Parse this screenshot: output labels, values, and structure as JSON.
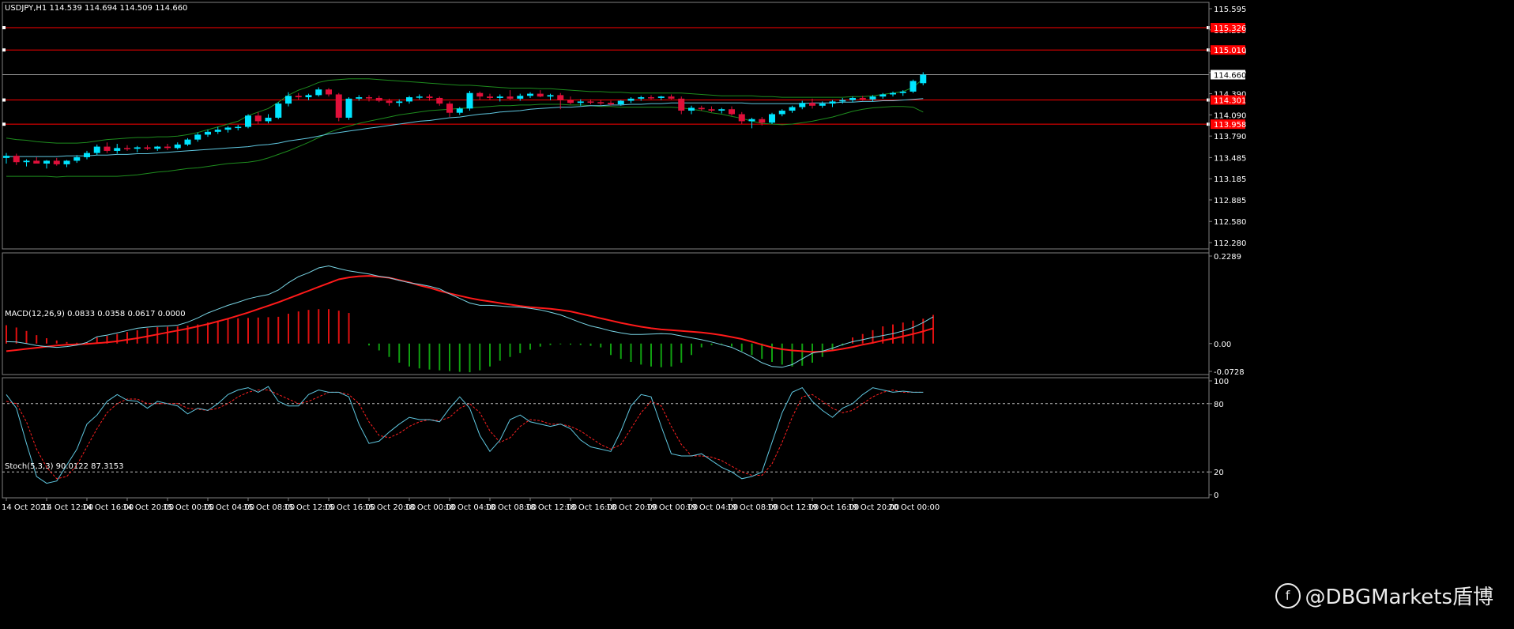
{
  "window": {
    "symbol_header": "USDJPY,H1  114.539 114.694 114.509 114.660"
  },
  "colors": {
    "background": "#000000",
    "bull_candle": "#00e5ff",
    "bear_candle": "#e0103a",
    "hline": "#ff0000",
    "bollinger": "#1e8c1e",
    "ma": "#5fc7e0",
    "macd_line": "#7ad6e6",
    "signal_line": "#ff1a1a",
    "hist_pos": "#e01010",
    "hist_neg": "#10a010",
    "stoch_main": "#5fc7e0",
    "stoch_signal": "#ff2020",
    "frame": "#808080"
  },
  "price_panel": {
    "ylim": [
      112.28,
      115.595
    ],
    "y_ticks": [
      "115.595",
      "115.295",
      "114.990",
      "114.690",
      "114.390",
      "114.090",
      "113.790",
      "113.485",
      "113.185",
      "112.885",
      "112.580",
      "112.280"
    ],
    "current_price": "114.660",
    "hlines": [
      {
        "value": 115.326,
        "label": "115.326"
      },
      {
        "value": 115.01,
        "label": "115.010"
      },
      {
        "value": 114.301,
        "label": "114.301"
      },
      {
        "value": 113.958,
        "label": "113.958"
      }
    ]
  },
  "macd_panel": {
    "header": "MACD(12,26,9) 0.0833 0.0358 0.0617 0.0000",
    "ylim": [
      -0.0728,
      0.2289
    ],
    "y_ticks": [
      "0.2289",
      "0.00",
      "-0.0728"
    ]
  },
  "stoch_panel": {
    "header": "Stoch(5,3,3) 90.0122 87.3153",
    "ylim": [
      0,
      100
    ],
    "y_ticks": [
      "100",
      "80",
      "20",
      "0"
    ],
    "levels": [
      80,
      20
    ]
  },
  "time_axis": {
    "labels": [
      "14 Oct 2021",
      "14 Oct 12:00",
      "14 Oct 16:00",
      "14 Oct 20:00",
      "15 Oct 00:00",
      "15 Oct 04:00",
      "15 Oct 08:00",
      "15 Oct 12:00",
      "15 Oct 16:00",
      "15 Oct 20:00",
      "18 Oct 00:00",
      "18 Oct 04:00",
      "18 Oct 08:00",
      "18 Oct 12:00",
      "18 Oct 16:00",
      "18 Oct 20:00",
      "19 Oct 00:00",
      "19 Oct 04:00",
      "19 Oct 08:00",
      "19 Oct 12:00",
      "19 Oct 16:00",
      "19 Oct 20:00",
      "20 Oct 00:00"
    ],
    "label_every_bars": 4
  },
  "chart_data": {
    "type": "candlestick",
    "symbol": "USDJPY",
    "timeframe": "H1",
    "ohlc": [
      [
        113.48,
        113.55,
        113.4,
        113.51
      ],
      [
        113.51,
        113.54,
        113.38,
        113.42
      ],
      [
        113.42,
        113.46,
        113.36,
        113.44
      ],
      [
        113.44,
        113.49,
        113.4,
        113.4
      ],
      [
        113.4,
        113.45,
        113.33,
        113.44
      ],
      [
        113.44,
        113.48,
        113.37,
        113.39
      ],
      [
        113.39,
        113.45,
        113.35,
        113.44
      ],
      [
        113.44,
        113.52,
        113.41,
        113.49
      ],
      [
        113.49,
        113.58,
        113.46,
        113.55
      ],
      [
        113.55,
        113.67,
        113.52,
        113.64
      ],
      [
        113.64,
        113.7,
        113.55,
        113.58
      ],
      [
        113.58,
        113.68,
        113.54,
        113.62
      ],
      [
        113.62,
        113.66,
        113.58,
        113.61
      ],
      [
        113.61,
        113.65,
        113.56,
        113.63
      ],
      [
        113.63,
        113.66,
        113.59,
        113.61
      ],
      [
        113.61,
        113.65,
        113.58,
        113.64
      ],
      [
        113.64,
        113.68,
        113.59,
        113.62
      ],
      [
        113.62,
        113.7,
        113.6,
        113.67
      ],
      [
        113.67,
        113.76,
        113.65,
        113.74
      ],
      [
        113.74,
        113.84,
        113.71,
        113.81
      ],
      [
        113.81,
        113.88,
        113.78,
        113.85
      ],
      [
        113.85,
        113.92,
        113.82,
        113.88
      ],
      [
        113.88,
        113.93,
        113.84,
        113.91
      ],
      [
        113.91,
        113.95,
        113.87,
        113.92
      ],
      [
        113.92,
        114.1,
        113.9,
        114.08
      ],
      [
        114.08,
        114.13,
        113.96,
        114.0
      ],
      [
        114.0,
        114.1,
        113.97,
        114.05
      ],
      [
        114.05,
        114.27,
        114.03,
        114.25
      ],
      [
        114.25,
        114.41,
        114.21,
        114.36
      ],
      [
        114.36,
        114.4,
        114.3,
        114.34
      ],
      [
        114.34,
        114.39,
        114.3,
        114.37
      ],
      [
        114.37,
        114.48,
        114.35,
        114.45
      ],
      [
        114.45,
        114.47,
        114.35,
        114.38
      ],
      [
        114.38,
        114.4,
        114.0,
        114.05
      ],
      [
        114.05,
        114.34,
        114.02,
        114.32
      ],
      [
        114.32,
        114.37,
        114.29,
        114.34
      ],
      [
        114.34,
        114.37,
        114.28,
        114.33
      ],
      [
        114.33,
        114.36,
        114.27,
        114.29
      ],
      [
        114.29,
        114.32,
        114.22,
        114.26
      ],
      [
        114.26,
        114.31,
        114.21,
        114.28
      ],
      [
        114.28,
        114.36,
        114.25,
        114.34
      ],
      [
        114.34,
        114.38,
        114.31,
        114.35
      ],
      [
        114.35,
        114.38,
        114.29,
        114.33
      ],
      [
        114.33,
        114.35,
        114.22,
        114.25
      ],
      [
        114.25,
        114.28,
        114.06,
        114.12
      ],
      [
        114.12,
        114.2,
        114.09,
        114.18
      ],
      [
        114.18,
        114.43,
        114.15,
        114.4
      ],
      [
        114.4,
        114.42,
        114.3,
        114.35
      ],
      [
        114.35,
        114.39,
        114.3,
        114.33
      ],
      [
        114.33,
        114.38,
        114.28,
        114.35
      ],
      [
        114.35,
        114.44,
        114.3,
        114.32
      ],
      [
        114.32,
        114.39,
        114.29,
        114.36
      ],
      [
        114.36,
        114.41,
        114.33,
        114.39
      ],
      [
        114.39,
        114.44,
        114.34,
        114.35
      ],
      [
        114.35,
        114.39,
        114.3,
        114.37
      ],
      [
        114.37,
        114.4,
        114.17,
        114.3
      ],
      [
        114.3,
        114.35,
        114.24,
        114.26
      ],
      [
        114.26,
        114.31,
        114.22,
        114.28
      ],
      [
        114.28,
        114.31,
        114.24,
        114.27
      ],
      [
        114.27,
        114.3,
        114.23,
        114.26
      ],
      [
        114.26,
        114.29,
        114.22,
        114.24
      ],
      [
        114.24,
        114.3,
        114.22,
        114.29
      ],
      [
        114.29,
        114.34,
        114.26,
        114.32
      ],
      [
        114.32,
        114.36,
        114.29,
        114.34
      ],
      [
        114.34,
        114.37,
        114.31,
        114.33
      ],
      [
        114.33,
        114.36,
        114.3,
        114.35
      ],
      [
        114.35,
        114.38,
        114.31,
        114.32
      ],
      [
        114.32,
        114.35,
        114.1,
        114.15
      ],
      [
        114.15,
        114.22,
        114.1,
        114.19
      ],
      [
        114.19,
        114.22,
        114.15,
        114.17
      ],
      [
        114.17,
        114.21,
        114.13,
        114.15
      ],
      [
        114.15,
        114.19,
        114.11,
        114.17
      ],
      [
        114.17,
        114.21,
        114.08,
        114.1
      ],
      [
        114.1,
        114.13,
        113.96,
        114.0
      ],
      [
        114.0,
        114.05,
        113.9,
        114.03
      ],
      [
        114.03,
        114.06,
        113.94,
        113.98
      ],
      [
        113.98,
        114.12,
        113.96,
        114.1
      ],
      [
        114.1,
        114.17,
        114.07,
        114.15
      ],
      [
        114.15,
        114.22,
        114.12,
        114.2
      ],
      [
        114.2,
        114.29,
        114.17,
        114.26
      ],
      [
        114.26,
        114.32,
        114.18,
        114.22
      ],
      [
        114.22,
        114.28,
        114.19,
        114.25
      ],
      [
        114.25,
        114.3,
        114.2,
        114.28
      ],
      [
        114.28,
        114.33,
        114.25,
        114.3
      ],
      [
        114.3,
        114.35,
        114.27,
        114.33
      ],
      [
        114.33,
        114.36,
        114.29,
        114.31
      ],
      [
        114.31,
        114.37,
        114.28,
        114.35
      ],
      [
        114.35,
        114.4,
        114.32,
        114.38
      ],
      [
        114.38,
        114.42,
        114.35,
        114.4
      ],
      [
        114.4,
        114.44,
        114.36,
        114.42
      ],
      [
        114.42,
        114.59,
        114.4,
        114.57
      ],
      [
        114.539,
        114.694,
        114.509,
        114.66
      ]
    ],
    "bollinger_upper": [
      113.76,
      113.74,
      113.73,
      113.71,
      113.7,
      113.69,
      113.69,
      113.69,
      113.7,
      113.72,
      113.74,
      113.75,
      113.76,
      113.77,
      113.77,
      113.78,
      113.78,
      113.79,
      113.81,
      113.84,
      113.88,
      113.92,
      113.96,
      114.0,
      114.08,
      114.13,
      114.18,
      114.27,
      114.37,
      114.44,
      114.49,
      114.55,
      114.58,
      114.59,
      114.6,
      114.6,
      114.6,
      114.59,
      114.58,
      114.57,
      114.56,
      114.55,
      114.54,
      114.53,
      114.52,
      114.51,
      114.51,
      114.5,
      114.49,
      114.48,
      114.47,
      114.47,
      114.47,
      114.46,
      114.46,
      114.45,
      114.44,
      114.43,
      114.42,
      114.42,
      114.41,
      114.41,
      114.4,
      114.4,
      114.4,
      114.4,
      114.4,
      114.4,
      114.39,
      114.38,
      114.37,
      114.36,
      114.36,
      114.36,
      114.36,
      114.35,
      114.35,
      114.34,
      114.34,
      114.34,
      114.34,
      114.34,
      114.34,
      114.34,
      114.35,
      114.35,
      114.36,
      114.38,
      114.4,
      114.42,
      114.48,
      114.6
    ],
    "bollinger_lower": [
      113.22,
      113.22,
      113.22,
      113.22,
      113.22,
      113.21,
      113.22,
      113.22,
      113.22,
      113.22,
      113.22,
      113.22,
      113.23,
      113.24,
      113.26,
      113.28,
      113.29,
      113.31,
      113.33,
      113.34,
      113.36,
      113.38,
      113.4,
      113.41,
      113.42,
      113.44,
      113.48,
      113.53,
      113.58,
      113.64,
      113.7,
      113.77,
      113.84,
      113.89,
      113.93,
      113.97,
      114.0,
      114.03,
      114.06,
      114.09,
      114.11,
      114.13,
      114.15,
      114.16,
      114.17,
      114.18,
      114.19,
      114.2,
      114.21,
      114.22,
      114.22,
      114.23,
      114.23,
      114.24,
      114.24,
      114.24,
      114.23,
      114.23,
      114.22,
      114.21,
      114.21,
      114.2,
      114.2,
      114.2,
      114.2,
      114.2,
      114.2,
      114.19,
      114.17,
      114.15,
      114.12,
      114.1,
      114.07,
      114.04,
      114.0,
      113.97,
      113.96,
      113.95,
      113.96,
      113.98,
      114.0,
      114.03,
      114.06,
      114.1,
      114.14,
      114.17,
      114.19,
      114.2,
      114.21,
      114.21,
      114.2,
      114.13
    ],
    "moving_average": [
      113.5,
      113.5,
      113.5,
      113.5,
      113.5,
      113.5,
      113.51,
      113.51,
      113.51,
      113.52,
      113.52,
      113.53,
      113.53,
      113.54,
      113.54,
      113.55,
      113.56,
      113.57,
      113.58,
      113.59,
      113.6,
      113.61,
      113.62,
      113.63,
      113.64,
      113.66,
      113.67,
      113.69,
      113.72,
      113.74,
      113.76,
      113.79,
      113.82,
      113.84,
      113.86,
      113.88,
      113.9,
      113.92,
      113.94,
      113.96,
      113.98,
      114.0,
      114.01,
      114.03,
      114.05,
      114.06,
      114.08,
      114.1,
      114.11,
      114.13,
      114.14,
      114.15,
      114.17,
      114.18,
      114.19,
      114.2,
      114.2,
      114.21,
      114.22,
      114.22,
      114.23,
      114.23,
      114.24,
      114.24,
      114.25,
      114.25,
      114.26,
      114.26,
      114.26,
      114.26,
      114.26,
      114.26,
      114.26,
      114.26,
      114.25,
      114.25,
      114.25,
      114.25,
      114.25,
      114.25,
      114.26,
      114.26,
      114.26,
      114.27,
      114.27,
      114.28,
      114.28,
      114.29,
      114.29,
      114.3,
      114.31,
      114.32
    ],
    "macd_main": [
      0.005,
      0.004,
      0.0,
      -0.005,
      -0.008,
      -0.01,
      -0.008,
      -0.004,
      0.003,
      0.018,
      0.022,
      0.028,
      0.034,
      0.04,
      0.043,
      0.045,
      0.046,
      0.048,
      0.056,
      0.067,
      0.08,
      0.09,
      0.1,
      0.108,
      0.117,
      0.123,
      0.128,
      0.14,
      0.159,
      0.175,
      0.185,
      0.198,
      0.203,
      0.196,
      0.19,
      0.186,
      0.182,
      0.176,
      0.172,
      0.165,
      0.159,
      0.155,
      0.15,
      0.143,
      0.13,
      0.118,
      0.106,
      0.1,
      0.1,
      0.098,
      0.096,
      0.095,
      0.092,
      0.088,
      0.082,
      0.075,
      0.065,
      0.055,
      0.046,
      0.04,
      0.033,
      0.028,
      0.024,
      0.024,
      0.025,
      0.026,
      0.025,
      0.02,
      0.015,
      0.01,
      0.004,
      -0.003,
      -0.01,
      -0.022,
      -0.035,
      -0.05,
      -0.06,
      -0.062,
      -0.055,
      -0.04,
      -0.025,
      -0.02,
      -0.012,
      -0.003,
      0.005,
      0.01,
      0.016,
      0.021,
      0.026,
      0.033,
      0.042,
      0.055,
      0.07
    ],
    "macd_signal": [
      -0.02,
      -0.017,
      -0.014,
      -0.011,
      -0.008,
      -0.005,
      -0.003,
      -0.002,
      -0.001,
      0.001,
      0.003,
      0.006,
      0.01,
      0.014,
      0.019,
      0.024,
      0.029,
      0.034,
      0.039,
      0.045,
      0.051,
      0.058,
      0.065,
      0.073,
      0.081,
      0.09,
      0.099,
      0.108,
      0.118,
      0.128,
      0.138,
      0.148,
      0.158,
      0.168,
      0.173,
      0.176,
      0.177,
      0.175,
      0.172,
      0.166,
      0.16,
      0.152,
      0.146,
      0.138,
      0.131,
      0.125,
      0.119,
      0.114,
      0.11,
      0.106,
      0.102,
      0.098,
      0.095,
      0.093,
      0.091,
      0.088,
      0.084,
      0.078,
      0.072,
      0.066,
      0.06,
      0.054,
      0.049,
      0.044,
      0.04,
      0.037,
      0.035,
      0.033,
      0.031,
      0.029,
      0.026,
      0.022,
      0.017,
      0.012,
      0.005,
      -0.003,
      -0.01,
      -0.015,
      -0.018,
      -0.02,
      -0.022,
      -0.021,
      -0.018,
      -0.014,
      -0.009,
      -0.003,
      0.002,
      0.008,
      0.013,
      0.019,
      0.025,
      0.032,
      0.04
    ],
    "macd_hist": [
      0.048,
      0.042,
      0.033,
      0.022,
      0.014,
      0.008,
      0.004,
      0.002,
      0.003,
      0.016,
      0.02,
      0.025,
      0.03,
      0.035,
      0.04,
      0.043,
      0.044,
      0.045,
      0.047,
      0.05,
      0.055,
      0.06,
      0.064,
      0.066,
      0.067,
      0.068,
      0.069,
      0.07,
      0.078,
      0.084,
      0.088,
      0.09,
      0.09,
      0.086,
      0.08,
      0.0,
      -0.005,
      -0.018,
      -0.035,
      -0.05,
      -0.06,
      -0.065,
      -0.068,
      -0.07,
      -0.072,
      -0.074,
      -0.075,
      -0.07,
      -0.06,
      -0.045,
      -0.035,
      -0.025,
      -0.016,
      -0.008,
      -0.004,
      -0.002,
      -0.003,
      -0.004,
      -0.006,
      -0.01,
      -0.03,
      -0.04,
      -0.048,
      -0.055,
      -0.06,
      -0.062,
      -0.06,
      -0.05,
      -0.03,
      -0.01,
      -0.004,
      -0.002,
      -0.008,
      -0.02,
      -0.03,
      -0.04,
      -0.048,
      -0.055,
      -0.06,
      -0.058,
      -0.05,
      -0.035,
      -0.02,
      -0.005,
      0.016,
      0.025,
      0.035,
      0.045,
      0.05,
      0.055,
      0.06,
      0.065,
      0.075
    ],
    "stoch_main": [
      88,
      76,
      45,
      16,
      10,
      12,
      26,
      40,
      62,
      70,
      82,
      88,
      83,
      82,
      76,
      82,
      80,
      78,
      71,
      76,
      74,
      80,
      88,
      92,
      94,
      90,
      95,
      82,
      78,
      78,
      88,
      92,
      90,
      90,
      86,
      62,
      45,
      47,
      55,
      62,
      68,
      66,
      66,
      64,
      76,
      86,
      76,
      52,
      38,
      48,
      66,
      70,
      64,
      62,
      60,
      62,
      58,
      48,
      42,
      40,
      38,
      56,
      78,
      88,
      86,
      60,
      36,
      34,
      34,
      36,
      30,
      24,
      20,
      14,
      16,
      20,
      46,
      72,
      90,
      94,
      82,
      74,
      68,
      76,
      80,
      88,
      94,
      92,
      90,
      91,
      90,
      90
    ],
    "stoch_signal": [
      82,
      80,
      64,
      40,
      24,
      14,
      16,
      26,
      42,
      58,
      72,
      80,
      84,
      84,
      80,
      80,
      80,
      80,
      76,
      75,
      74,
      76,
      80,
      86,
      90,
      92,
      92,
      88,
      84,
      80,
      82,
      86,
      90,
      90,
      88,
      80,
      64,
      52,
      50,
      54,
      60,
      64,
      66,
      65,
      68,
      76,
      80,
      72,
      56,
      46,
      50,
      60,
      66,
      65,
      62,
      62,
      60,
      56,
      50,
      44,
      40,
      44,
      58,
      72,
      82,
      78,
      60,
      44,
      34,
      34,
      33,
      30,
      25,
      20,
      17,
      17,
      27,
      46,
      68,
      86,
      88,
      82,
      76,
      72,
      74,
      80,
      86,
      90,
      92,
      90,
      90,
      90
    ]
  }
}
